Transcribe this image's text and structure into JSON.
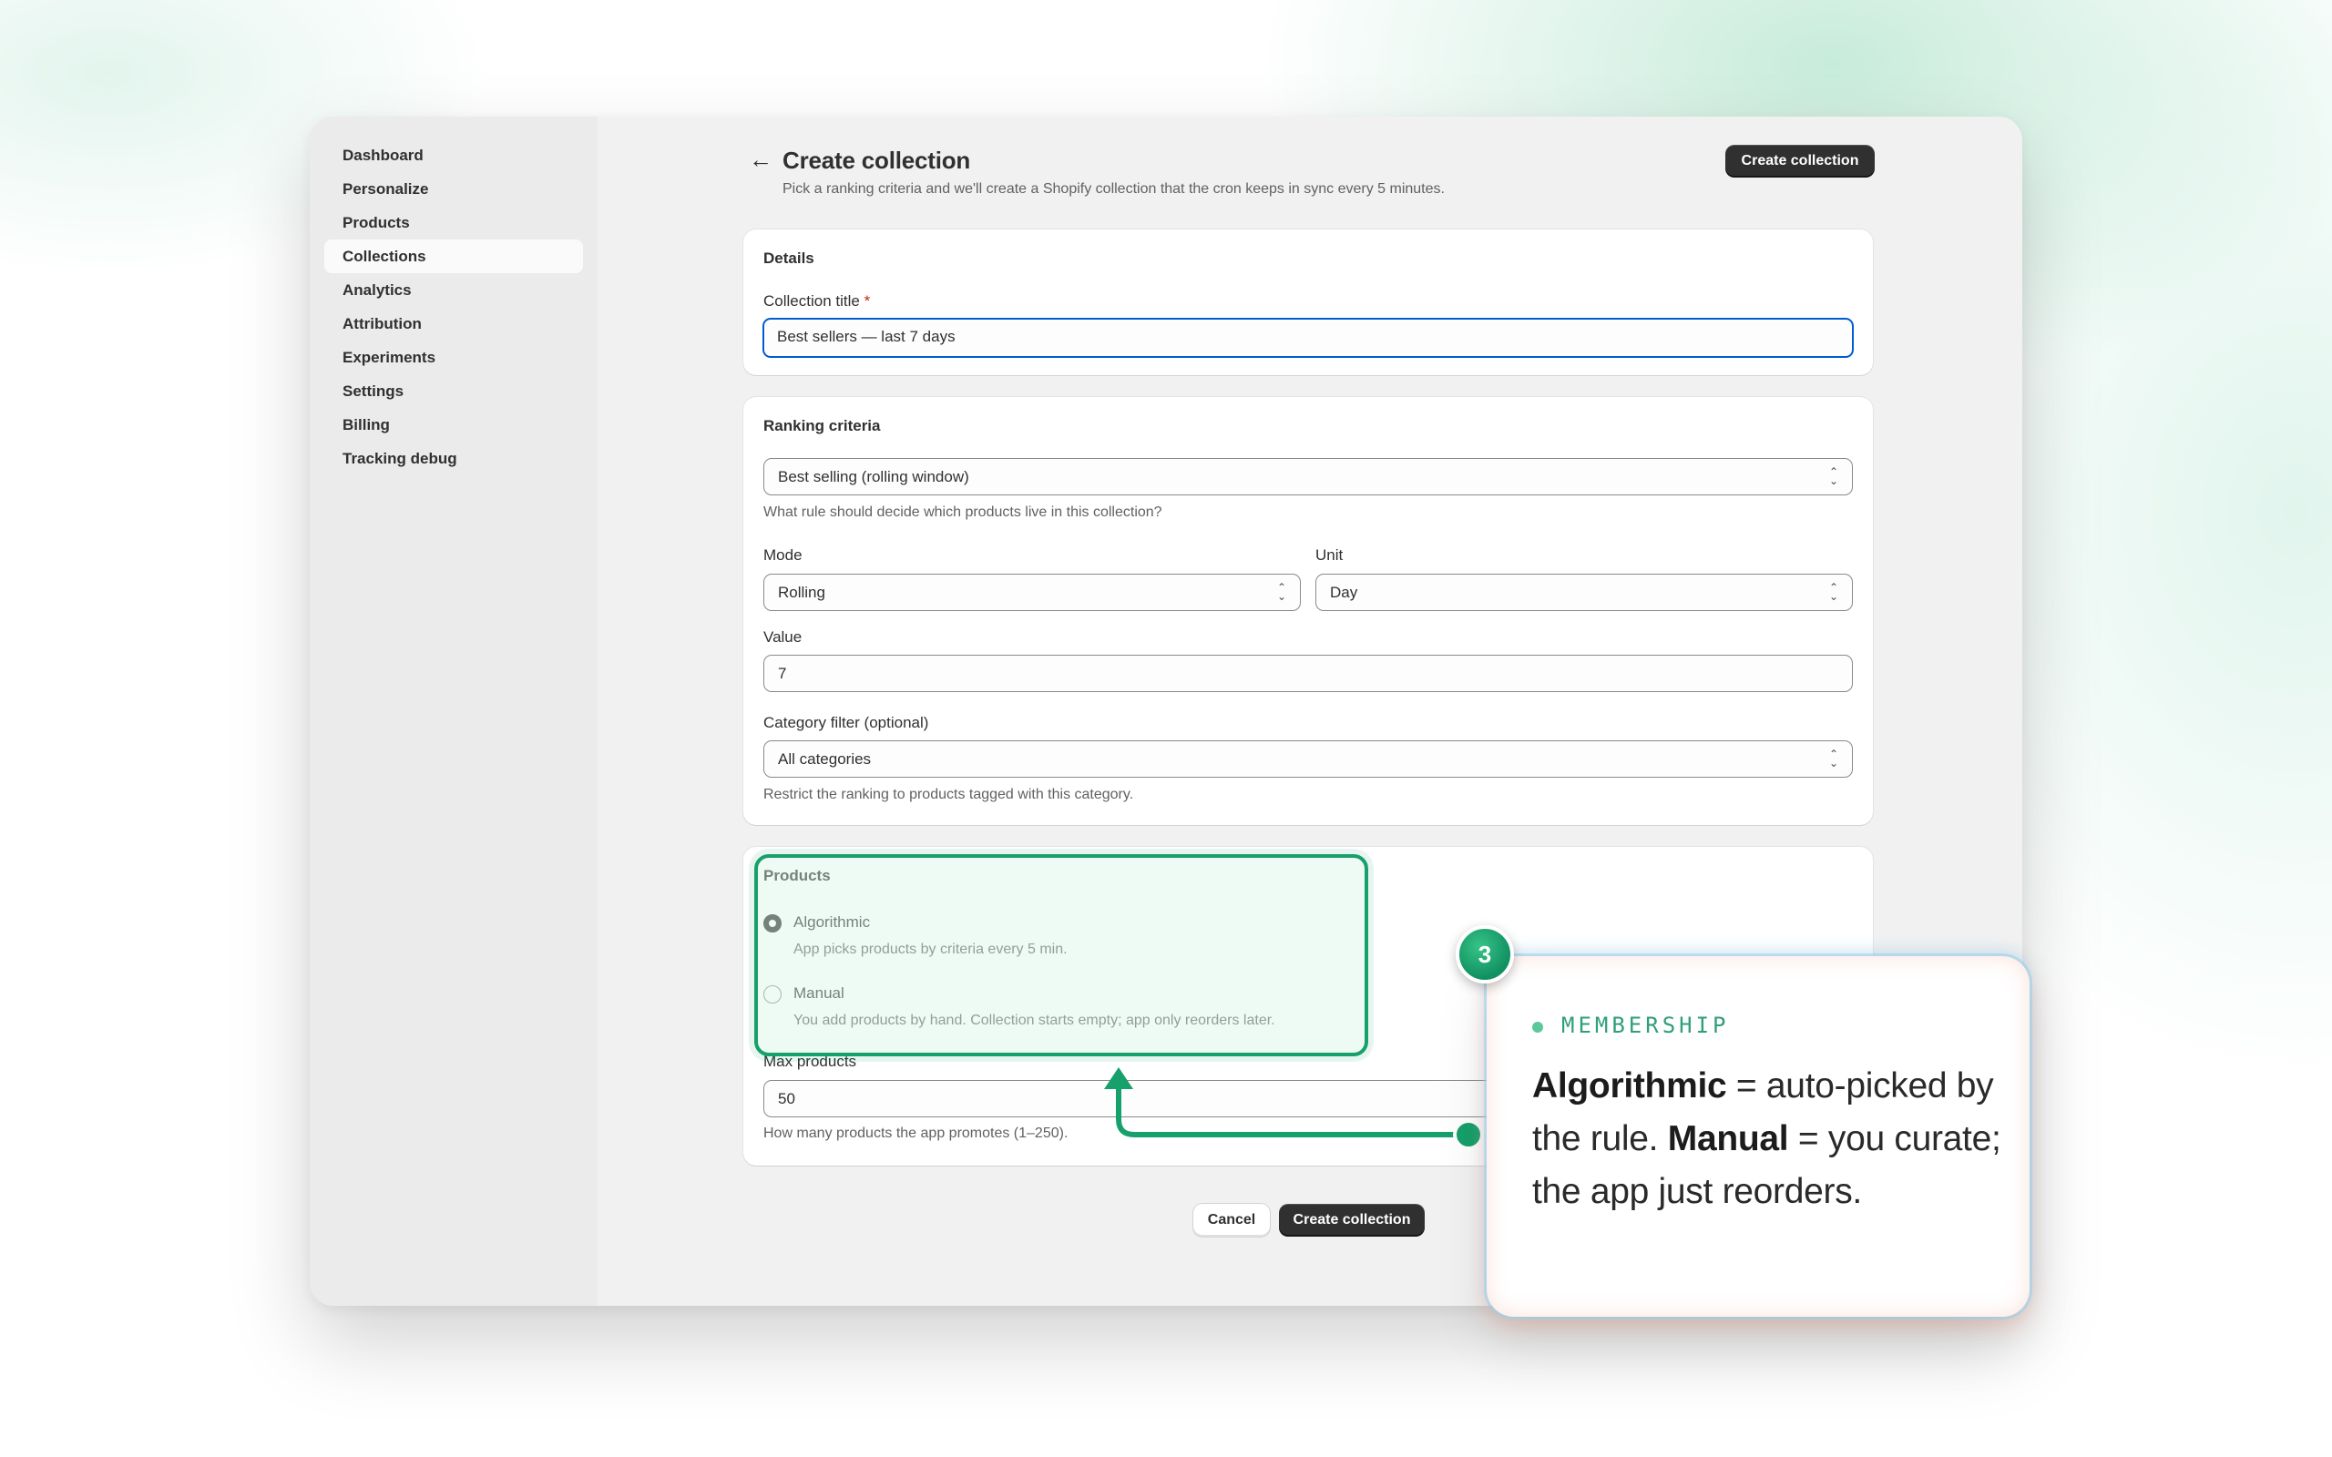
{
  "sidebar": {
    "items": [
      {
        "label": "Dashboard"
      },
      {
        "label": "Personalize"
      },
      {
        "label": "Products"
      },
      {
        "label": "Collections",
        "active": true
      },
      {
        "label": "Analytics"
      },
      {
        "label": "Attribution"
      },
      {
        "label": "Experiments"
      },
      {
        "label": "Settings"
      },
      {
        "label": "Billing"
      },
      {
        "label": "Tracking debug"
      }
    ]
  },
  "header": {
    "back_icon": "arrow-left-icon",
    "title": "Create collection",
    "subtitle": "Pick a ranking criteria and we'll create a Shopify collection that the cron keeps in sync every 5 minutes.",
    "primary_button": "Create collection"
  },
  "details": {
    "title": "Details",
    "collection_title_label": "Collection title",
    "required_mark": "*",
    "collection_title_value": "Best sellers — last 7 days"
  },
  "ranking": {
    "title": "Ranking criteria",
    "criteria_value": "Best selling (rolling window)",
    "criteria_help": "What rule should decide which products live in this collection?",
    "mode_label": "Mode",
    "mode_value": "Rolling",
    "unit_label": "Unit",
    "unit_value": "Day",
    "value_label": "Value",
    "value_value": "7",
    "category_label": "Category filter (optional)",
    "category_value": "All categories",
    "category_help": "Restrict the ranking to products tagged with this category."
  },
  "products": {
    "title": "Products",
    "options": [
      {
        "label": "Algorithmic",
        "help": "App picks products by criteria every 5 min.",
        "checked": true
      },
      {
        "label": "Manual",
        "help": "You add products by hand. Collection starts empty; app only reorders later.",
        "checked": false
      }
    ],
    "max_label": "Max products",
    "max_value": "50",
    "max_help": "How many products the app promotes (1–250)."
  },
  "footer": {
    "cancel": "Cancel",
    "create": "Create collection"
  },
  "callout": {
    "step": "3",
    "kicker": "MEMBERSHIP",
    "term1": "Algorithmic",
    "text1": " = auto-picked by the rule. ",
    "term2": "Manual",
    "text2": " = you curate; the app just reorders."
  },
  "colors": {
    "accent": "#17a06b",
    "primary_button": "#303030",
    "focus": "#005bd3"
  }
}
